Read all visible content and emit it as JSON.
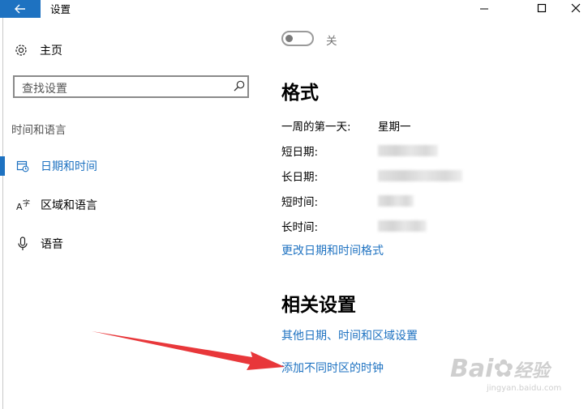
{
  "window": {
    "title": "设置",
    "back_icon": "arrow-left-icon",
    "controls": [
      "minimize-icon",
      "maximize-icon",
      "close-icon"
    ]
  },
  "sidebar": {
    "home_label": "主页",
    "search_placeholder": "查找设置",
    "section_title": "时间和语言",
    "items": [
      {
        "label": "日期和时间",
        "icon": "calendar-clock-icon",
        "selected": true
      },
      {
        "label": "区域和语言",
        "icon": "language-icon",
        "selected": false
      },
      {
        "label": "语音",
        "icon": "microphone-icon",
        "selected": false
      }
    ]
  },
  "main": {
    "toggle": {
      "state_label": "关",
      "on": false
    },
    "format": {
      "title": "格式",
      "rows": [
        {
          "label": "一周的第一天:",
          "value": "星期一"
        },
        {
          "label": "短日期:",
          "value": ""
        },
        {
          "label": "长日期:",
          "value": ""
        },
        {
          "label": "短时间:",
          "value": ""
        },
        {
          "label": "长时间:",
          "value": ""
        }
      ],
      "change_link": "更改日期和时间格式"
    },
    "related": {
      "title": "相关设置",
      "links": [
        "其他日期、时间和区域设置",
        "添加不同时区的时钟"
      ]
    }
  },
  "colors": {
    "accent": "#1e72c1",
    "annotation_arrow": "#e8373a"
  },
  "watermark": {
    "brand": "Bai",
    "brand_cn": "经验",
    "url": "jingyan.baidu.com"
  }
}
